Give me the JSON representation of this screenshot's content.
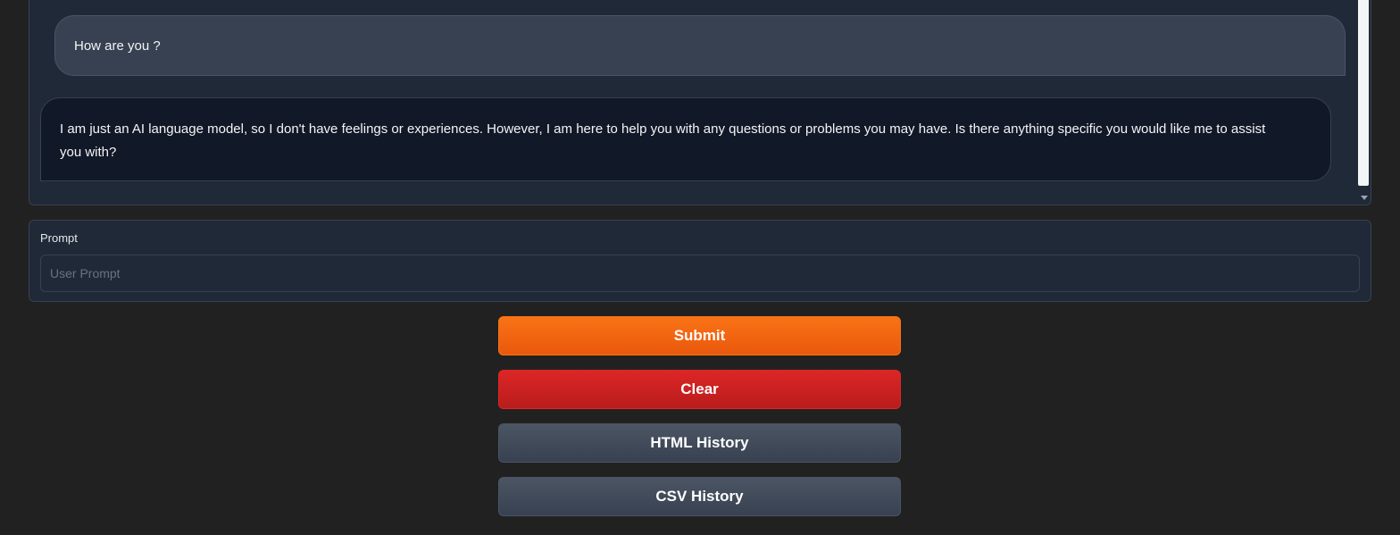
{
  "chat": {
    "messages": [
      {
        "role": "user",
        "text": "How are you ?"
      },
      {
        "role": "bot",
        "text": "I am just an AI language model, so I don't have feelings or experiences. However, I am here to help you with any questions or problems you may have. Is there anything specific you would like me to assist you with?"
      }
    ]
  },
  "prompt": {
    "label": "Prompt",
    "placeholder": "User Prompt",
    "value": ""
  },
  "buttons": {
    "submit": "Submit",
    "clear": "Clear",
    "html_history": "HTML History",
    "csv_history": "CSV History"
  },
  "colors": {
    "submit": "#f97316",
    "clear": "#dc2626",
    "secondary": "#4b5563",
    "panel": "#1f2937",
    "background": "#212121"
  }
}
